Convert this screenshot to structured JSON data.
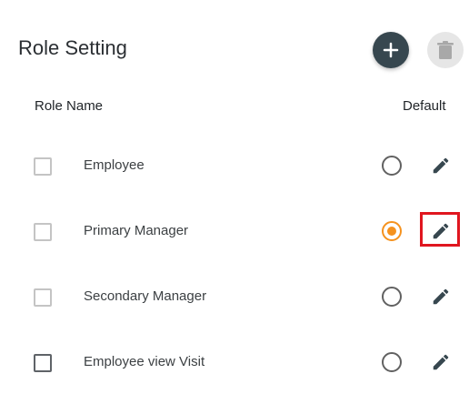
{
  "header": {
    "title": "Role Setting",
    "add_icon": "plus-icon",
    "delete_icon": "trash-icon"
  },
  "table": {
    "col_name": "Role Name",
    "col_default": "Default",
    "rows": [
      {
        "name": "Employee",
        "default": false,
        "checked": false
      },
      {
        "name": "Primary Manager",
        "default": true,
        "checked": false
      },
      {
        "name": "Secondary Manager",
        "default": false,
        "checked": false
      },
      {
        "name": "Employee view Visit",
        "default": false,
        "checked": false
      }
    ]
  },
  "colors": {
    "accent": "#f5921e",
    "primary": "#37474f",
    "highlight": "#e0161f"
  }
}
